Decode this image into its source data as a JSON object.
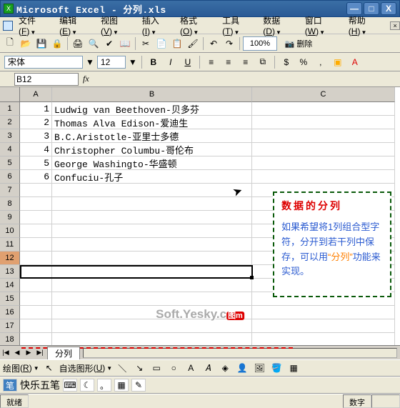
{
  "title": "Microsoft Excel - 分列.xls",
  "winbtns": {
    "min": "―",
    "max": "□",
    "close": "X"
  },
  "menus": [
    {
      "label": "文件",
      "ak": "F"
    },
    {
      "label": "编辑",
      "ak": "E"
    },
    {
      "label": "视图",
      "ak": "V"
    },
    {
      "label": "插入",
      "ak": "I"
    },
    {
      "label": "格式",
      "ak": "O"
    },
    {
      "label": "工具",
      "ak": "T"
    },
    {
      "label": "数据",
      "ak": "D"
    },
    {
      "label": "窗口",
      "ak": "W"
    },
    {
      "label": "帮助",
      "ak": "H"
    }
  ],
  "toolbar": {
    "icons": [
      "new",
      "open",
      "save",
      "perm",
      "print",
      "preview",
      "spell",
      "research",
      "cut",
      "copy",
      "paste",
      "painter",
      "undo",
      "redo",
      "link",
      "sum",
      "sort-asc",
      "sort-desc"
    ],
    "zoom": "100%",
    "cam_label": "📷 删除"
  },
  "format": {
    "font": "宋体",
    "size": "12",
    "align_icons": [
      "left",
      "center",
      "right",
      "merge"
    ],
    "style_icons": [
      "bold",
      "italic",
      "underline"
    ],
    "num_icons": [
      "currency",
      "percent",
      "comma",
      "dec+",
      "dec-",
      "indent-",
      "indent+",
      "border",
      "fill",
      "font-color"
    ]
  },
  "namebox": "B12",
  "fx_label": "fx",
  "columns": [
    "A",
    "B",
    "C"
  ],
  "rows": 18,
  "sel_row": 12,
  "cells": {
    "r1": {
      "a": "1",
      "b": "Ludwig van Beethoven-贝多芬"
    },
    "r2": {
      "a": "2",
      "b": "Thomas Alva Edison-爱迪生"
    },
    "r3": {
      "a": "3",
      "b": "B.C.Aristotle-亚里士多德"
    },
    "r4": {
      "a": "4",
      "b": "Christopher Columbu-哥伦布"
    },
    "r5": {
      "a": "5",
      "b": "George Washingto-华盛顿"
    },
    "r6": {
      "a": "6",
      "b": "Confuciu-孔子"
    }
  },
  "tip": {
    "title": "数据的分列",
    "body_prefix": "如果希望将1列组合型字符，分开到若干列中保存，可以用",
    "body_hl": "“分列”",
    "body_suffix": "功能来实现。"
  },
  "watermark": {
    "txt": "Soft.Yesky.c",
    "tag": "图m"
  },
  "sheet_nav": [
    "|◀",
    "◀",
    "▶",
    "▶|"
  ],
  "sheet_tab": "分列",
  "drawbar": {
    "label": "绘图",
    "ak": "R",
    "auto": "自选图形",
    "ak2": "U",
    "shape_icons": [
      "line",
      "arrow",
      "rect",
      "oval",
      "textbox",
      "wordart",
      "diagram",
      "clipart",
      "image",
      "fill",
      "line-c",
      "font-c",
      "line-w",
      "dash",
      "arrow-s",
      "shadow",
      "3d"
    ]
  },
  "ime": {
    "name": "快乐五笔",
    "icons": [
      "kb",
      "cn",
      "full",
      "punct",
      "softkb",
      "config"
    ]
  },
  "status": {
    "ready": "就绪",
    "num": "数字"
  }
}
